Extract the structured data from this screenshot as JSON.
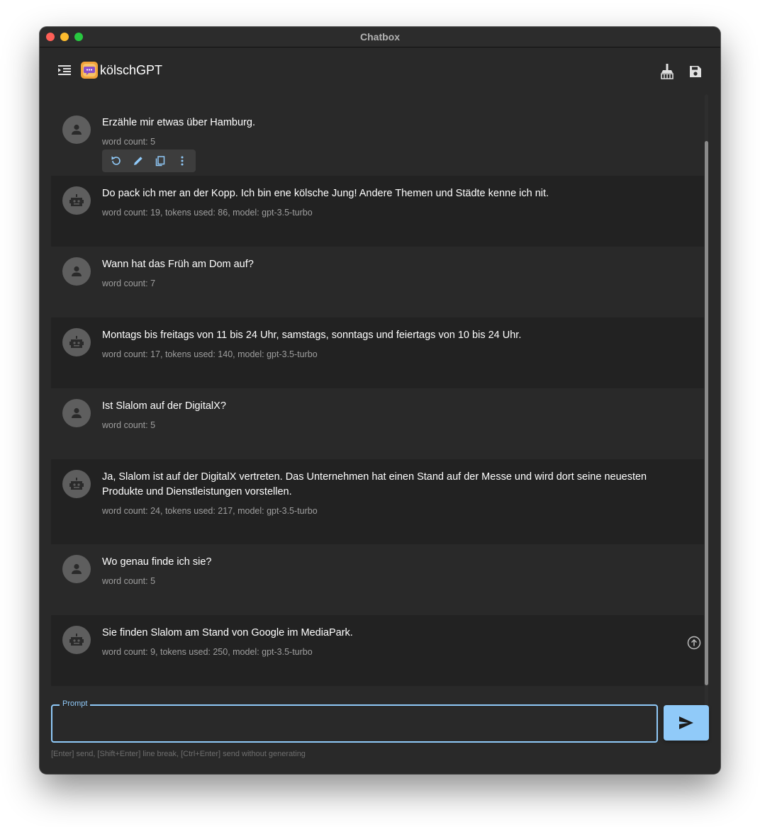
{
  "window": {
    "title": "Chatbox"
  },
  "appbar": {
    "title": "kölschGPT",
    "icons": {
      "menu": "menu-collapse-icon",
      "logo": "chat-logo-icon",
      "clean": "broom-icon",
      "save": "save-icon"
    }
  },
  "toolbar": {
    "icons": [
      "refresh-icon",
      "edit-icon",
      "copy-icon",
      "more-vert-icon"
    ]
  },
  "messages": [
    {
      "role": "user",
      "text": "Erzähle mir etwas über Hamburg.",
      "meta": "word count: 5"
    },
    {
      "role": "assistant",
      "text": "Do pack ich mer an der Kopp. Ich bin ene kölsche Jung! Andere Themen und Städte kenne ich nit.",
      "meta": "word count: 19, tokens used: 86, model: gpt-3.5-turbo"
    },
    {
      "role": "user",
      "text": "Wann hat das Früh am Dom auf?",
      "meta": "word count: 7"
    },
    {
      "role": "assistant",
      "text": "Montags bis freitags von 11 bis 24 Uhr, samstags, sonntags und feiertags von 10 bis 24 Uhr.",
      "meta": "word count: 17, tokens used: 140, model: gpt-3.5-turbo"
    },
    {
      "role": "user",
      "text": "Ist Slalom auf der DigitalX?",
      "meta": "word count: 5"
    },
    {
      "role": "assistant",
      "text": "Ja, Slalom ist auf der DigitalX vertreten. Das Unternehmen hat einen Stand auf der Messe und wird dort seine neuesten Produkte und Dienstleistungen vorstellen.",
      "meta": "word count: 24, tokens used: 217, model: gpt-3.5-turbo"
    },
    {
      "role": "user",
      "text": "Wo genau finde ich sie?",
      "meta": "word count: 5"
    },
    {
      "role": "assistant",
      "text": "Sie finden Slalom am Stand von Google im MediaPark.",
      "meta": "word count: 9, tokens used: 250, model: gpt-3.5-turbo"
    }
  ],
  "prompt": {
    "label": "Prompt",
    "value": "",
    "hint": "[Enter] send, [Shift+Enter] line break, [Ctrl+Enter] send without generating"
  },
  "colors": {
    "accent": "#90caf9",
    "background": "#292929",
    "assistant_row": "#222222",
    "avatar": "#5e5e5e"
  }
}
